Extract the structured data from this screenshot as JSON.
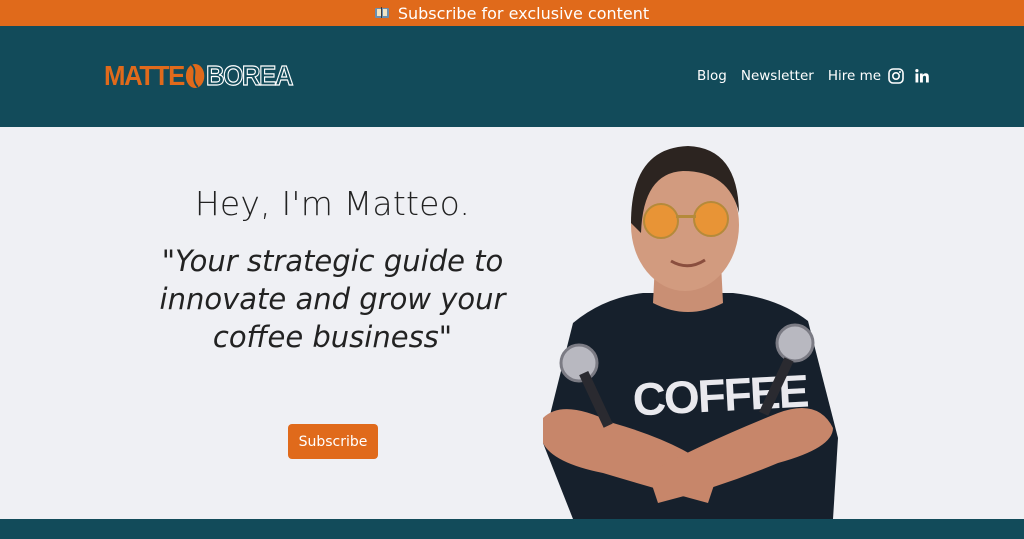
{
  "announcement": {
    "text": "Subscribe for exclusive content",
    "icon": "book-emoji-icon"
  },
  "brand": {
    "first": "MATTE",
    "last": "BOREA",
    "accent": "#e06a1b",
    "dark": "#124b5a"
  },
  "nav": {
    "items": [
      {
        "label": "Blog"
      },
      {
        "label": "Newsletter"
      },
      {
        "label": "Hire me"
      }
    ]
  },
  "social": {
    "icons": [
      "instagram-icon",
      "linkedin-icon"
    ]
  },
  "hero": {
    "greeting": "Hey, I'm Matteo.",
    "quote": "\"Your strategic guide to innovate and grow your coffee business\"",
    "cta": "Subscribe",
    "shirt_text": "COFFEE"
  }
}
